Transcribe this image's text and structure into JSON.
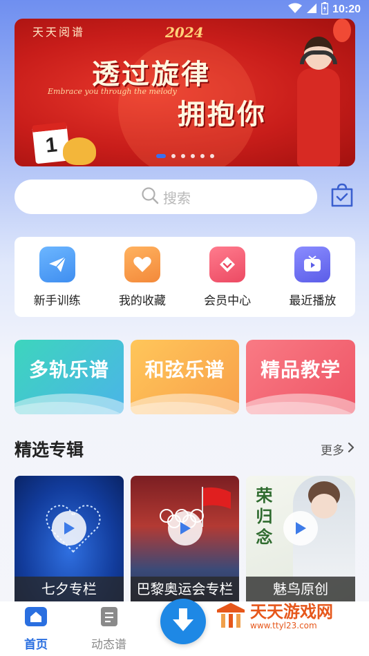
{
  "status_bar": {
    "time": "10:20",
    "icons": [
      "wifi-icon",
      "signal-icon",
      "battery-icon"
    ]
  },
  "banner": {
    "brand": "天天阅谱",
    "year": "2024",
    "headline_line1": "透过旋律",
    "headline_line2": "拥抱你",
    "subtitle": "Embrace you through the melody",
    "calendar_day": "1",
    "slides": 6,
    "active_slide": 0
  },
  "search": {
    "placeholder": "搜索"
  },
  "quick_menu": [
    {
      "label": "新手训练",
      "icon": "paper-plane-icon",
      "color": "#4a9cf5"
    },
    {
      "label": "我的收藏",
      "icon": "heart-icon",
      "color": "#f6994a"
    },
    {
      "label": "会员中心",
      "icon": "diamond-icon",
      "color": "#f0586f"
    },
    {
      "label": "最近播放",
      "icon": "tv-icon",
      "color": "#6b6cf2"
    }
  ],
  "categories": [
    {
      "label": "多轨乐谱",
      "color": "#35cdb8"
    },
    {
      "label": "和弦乐谱",
      "color": "#f9b64c"
    },
    {
      "label": "精品教学",
      "color": "#f2606e"
    }
  ],
  "section": {
    "title": "精选专辑",
    "more": "更多"
  },
  "albums": [
    {
      "title": "七夕专栏"
    },
    {
      "title": "巴黎奥运会专栏"
    },
    {
      "title": "魅鸟原创",
      "cover_text": "荣归念"
    }
  ],
  "bottom_nav": [
    {
      "label": "首页",
      "active": true,
      "color": "#2a6fe0"
    },
    {
      "label": "动态谱",
      "active": false,
      "color": "#8a8a8a"
    }
  ],
  "watermark": {
    "name": "天天游戏网",
    "url": "www.ttyl23.com"
  }
}
